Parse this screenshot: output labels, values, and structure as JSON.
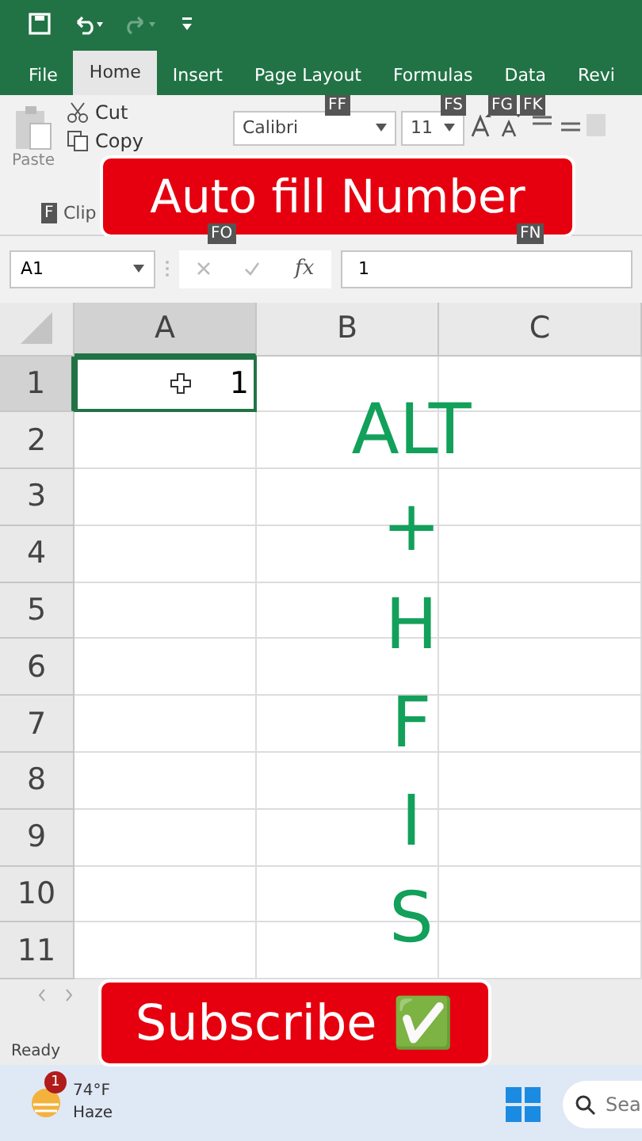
{
  "tabs": [
    {
      "label": "File",
      "selected": false
    },
    {
      "label": "Home",
      "selected": true
    },
    {
      "label": "Insert",
      "selected": false
    },
    {
      "label": "Page Layout",
      "selected": false
    },
    {
      "label": "Formulas",
      "selected": false
    },
    {
      "label": "Data",
      "selected": false
    },
    {
      "label": "Revi",
      "selected": false
    }
  ],
  "ribbon": {
    "paste": "Paste",
    "cut": "Cut",
    "copy": "Copy",
    "group_label": "Clip",
    "group_keytip": "F",
    "font_name": "Calibri",
    "font_size": "11",
    "font_keytips": [
      "FF",
      "FS",
      "FG",
      "FK"
    ]
  },
  "formula_bar": {
    "name_box": "A1",
    "keytips": [
      "FO",
      "FN"
    ],
    "function_label": "fx",
    "value": "1"
  },
  "columns": [
    {
      "label": "A",
      "selected": true
    },
    {
      "label": "B",
      "selected": false
    },
    {
      "label": "C",
      "selected": false
    }
  ],
  "rows": [
    {
      "label": "1",
      "selected": true,
      "value": "1"
    },
    {
      "label": "2",
      "selected": false
    },
    {
      "label": "3",
      "selected": false
    },
    {
      "label": "4",
      "selected": false
    },
    {
      "label": "5",
      "selected": false
    },
    {
      "label": "6",
      "selected": false
    },
    {
      "label": "7",
      "selected": false
    },
    {
      "label": "8",
      "selected": false
    },
    {
      "label": "9",
      "selected": false
    },
    {
      "label": "10",
      "selected": false
    },
    {
      "label": "11",
      "selected": false
    }
  ],
  "shortcut_letters": [
    "ALT",
    "+",
    "H",
    "F",
    "I",
    "S"
  ],
  "title_banner": "Auto fill Number",
  "subscribe_banner": "Subscribe ✅",
  "status_bar": "Ready",
  "taskbar": {
    "weather_badge": "1",
    "temperature": "74°F",
    "condition": "Haze",
    "search_placeholder": "Sea"
  }
}
